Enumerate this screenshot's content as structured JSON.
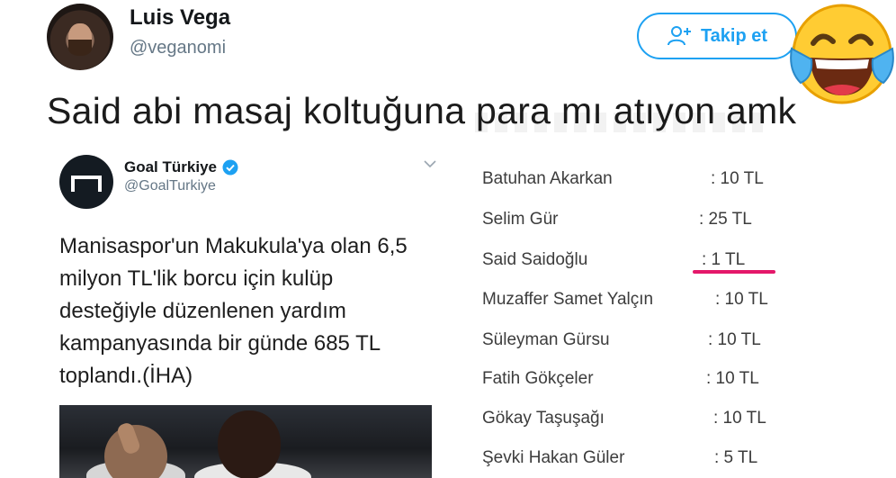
{
  "author": {
    "name": "Luis Vega",
    "handle": "@veganomi"
  },
  "follow_button": {
    "label": "Takip et",
    "icon": "add-user-icon",
    "color": "#1da1f2"
  },
  "emoji": "face-with-tears-of-joy-icon",
  "tweet_text": "Said abi masaj koltuğuna para mı atıyon amk",
  "embedded_tweet": {
    "name": "Goal Türkiye",
    "handle": "@GoalTurkiye",
    "verified": true,
    "text_lines": [
      "Manisaspor'un Makukula'ya olan 6,5",
      "milyon TL'lik borcu için kulüp",
      "desteğiyle düzenlenen yardım",
      "kampanyasında bir günde 685 TL",
      "toplandı.(İHA)"
    ]
  },
  "donations": [
    {
      "name": "Batuhan Akarkan",
      "amount": ": 10 TL"
    },
    {
      "name": "Selim Gür",
      "amount": ": 25 TL"
    },
    {
      "name": "Said Saidoğlu",
      "amount": ": 1 TL",
      "highlighted": true
    },
    {
      "name": "Muzaffer Samet Yalçın",
      "amount": ": 10 TL"
    },
    {
      "name": "Süleyman Gürsu",
      "amount": ": 10 TL"
    },
    {
      "name": "Fatih Gökçeler",
      "amount": ": 10 TL"
    },
    {
      "name": "Gökay Taşuşağı",
      "amount": ": 10 TL"
    },
    {
      "name": "Şevki Hakan Güler",
      "amount": ": 5 TL"
    }
  ],
  "highlight_color": "#e4186a"
}
